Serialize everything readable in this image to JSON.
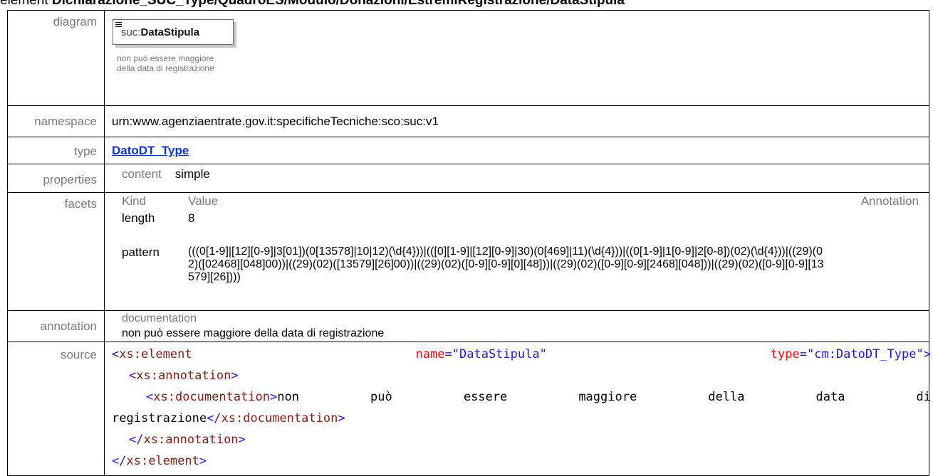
{
  "heading": {
    "prefix": "element ",
    "path": "Dichiarazione_SUC_Type/QuadroES/Modulo/Donazioni/EstremiRegistrazione/DataStipula"
  },
  "rows": {
    "diagram": "diagram",
    "namespace": "namespace",
    "type": "type",
    "properties": "properties",
    "facets": "facets",
    "annotation": "annotation",
    "source": "source"
  },
  "diagram": {
    "node_prefix": "suc:",
    "node_name": "DataStipula",
    "note_line1": "non può essere maggiore",
    "note_line2": "della data di registrazione",
    "icon": "element-doc-icon"
  },
  "namespace_value": "urn:www.agenziaentrate.gov.it:specificheTecniche:sco:suc:v1",
  "type_link": "DatoDT_Type",
  "properties": {
    "key": "content",
    "value": "simple"
  },
  "facets": {
    "headers": {
      "kind": "Kind",
      "value": "Value",
      "annotation": "Annotation"
    },
    "length": {
      "kind": "length",
      "value": "8"
    },
    "pattern": {
      "kind": "pattern",
      "value": "(((0[1-9]|[12][0-9]|3[01])(0[13578]|10|12)(\\d{4}))|(([0][1-9]|[12][0-9]|30)(0[469]|11)(\\d{4}))|((0[1-9]|1[0-9]|2[0-8])(02)(\\d{4}))|((29)(02)([02468][048]00))|((29)(02)([13579][26]00))|((29)(02)([0-9][0-9][0][48]))|((29)(02)([0-9][0-9][2468][048]))|((29)(02)([0-9][0-9][13579][26])))"
    }
  },
  "annotation": {
    "label": "documentation",
    "text": "non può essere maggiore della data di registrazione"
  },
  "source": {
    "l1_tag": "xs:element",
    "l1_attr1": "name",
    "l1_val1": "\"DataStipula\"",
    "l1_attr2": "type",
    "l1_val2": "\"cm:DatoDT_Type\"",
    "l2_tag": "xs:annotation",
    "l3_tag": "xs:documentation",
    "l3_w1": "non",
    "l3_w2": "può",
    "l3_w3": "essere",
    "l3_w4": "maggiore",
    "l3_w5": "della",
    "l3_w6": "data",
    "l3_w7": "di",
    "l4_text": "registrazione",
    "l4_tag": "xs:documentation",
    "l5_tag": "xs:annotation",
    "l6_tag": "xs:element"
  }
}
